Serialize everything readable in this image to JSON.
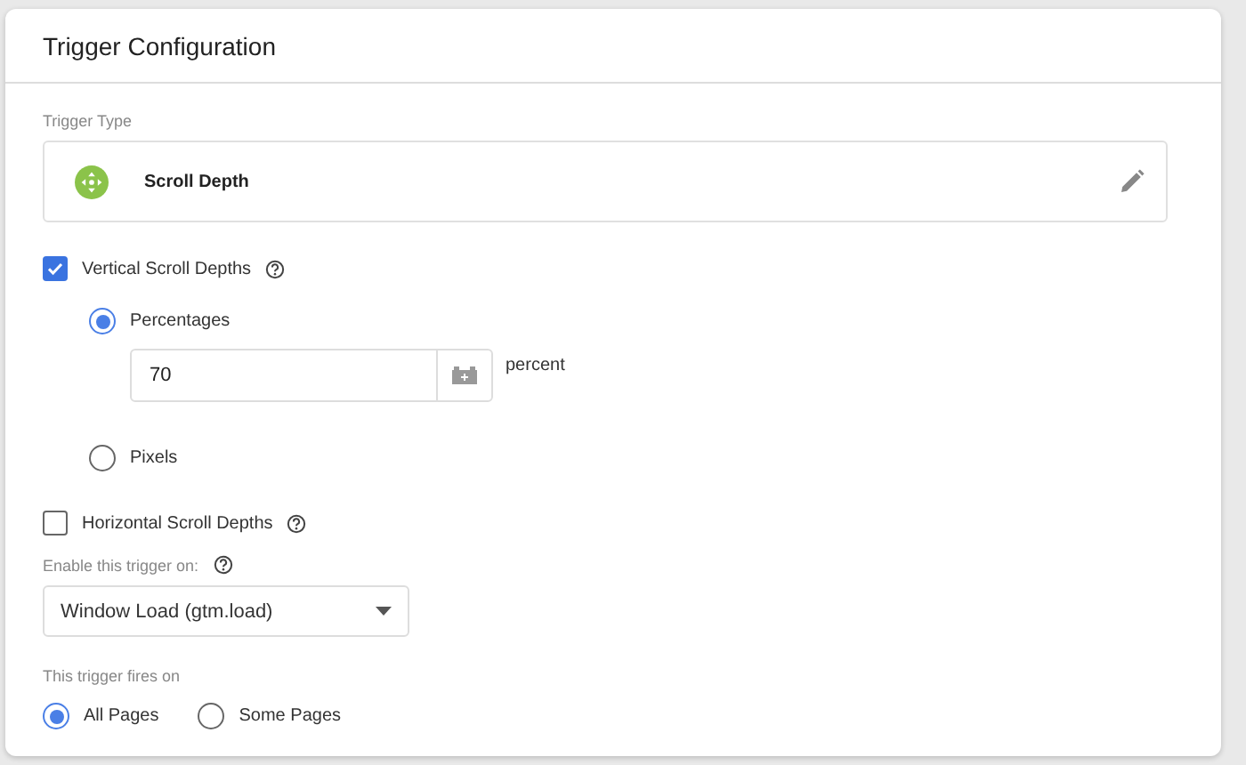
{
  "title": "Trigger Configuration",
  "trigger_type": {
    "label": "Trigger Type",
    "name": "Scroll Depth"
  },
  "vertical": {
    "label": "Vertical Scroll Depths",
    "checked": true,
    "options": [
      {
        "label": "Percentages",
        "selected": true,
        "input": {
          "value": "70",
          "unit": "percent"
        }
      },
      {
        "label": "Pixels",
        "selected": false
      }
    ]
  },
  "horizontal": {
    "label": "Horizontal Scroll Depths",
    "checked": false
  },
  "enable": {
    "label": "Enable this trigger on:",
    "value": "Window Load (gtm.load)"
  },
  "fires": {
    "label": "This trigger fires on",
    "options": [
      {
        "label": "All Pages",
        "selected": true
      },
      {
        "label": "Some Pages",
        "selected": false
      }
    ]
  }
}
